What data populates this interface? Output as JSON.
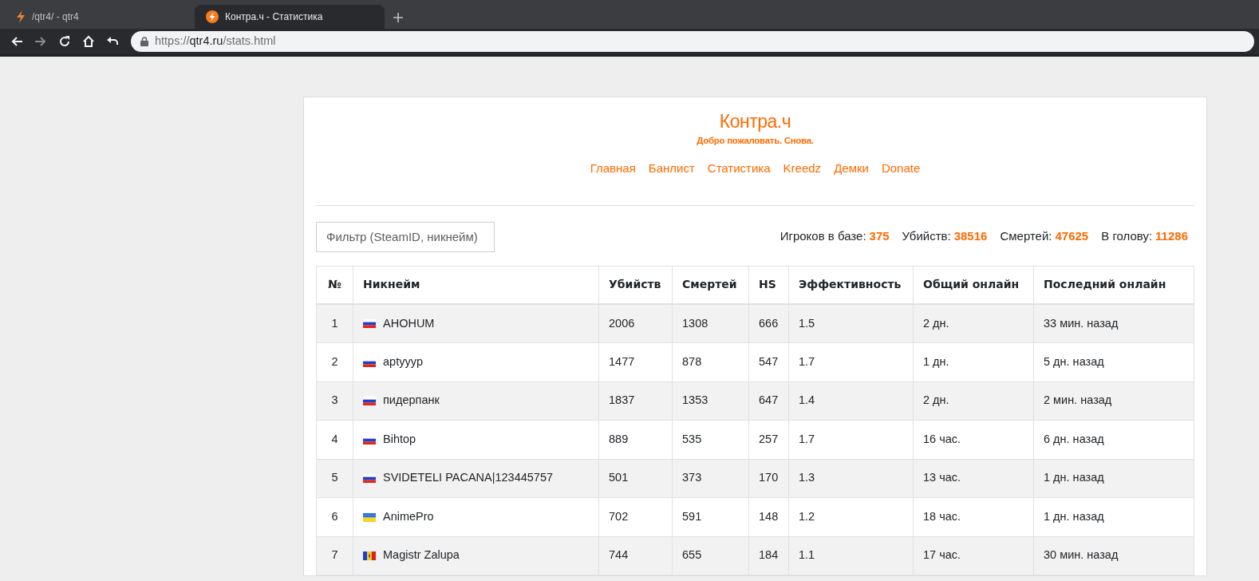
{
  "browser": {
    "tabs": [
      {
        "title": "/qtr4/ - qtr4",
        "kind": "bolt",
        "selected": false
      },
      {
        "title": "Контра.ч - Статистика",
        "kind": "disc",
        "selected": true
      }
    ],
    "nav_buttons": [
      {
        "kind": "back",
        "disabled": false
      },
      {
        "kind": "forward",
        "disabled": true
      },
      {
        "kind": "reload",
        "disabled": false
      },
      {
        "kind": "home",
        "disabled": false
      },
      {
        "kind": "undo",
        "disabled": false
      }
    ],
    "url": {
      "scheme": "https://",
      "host": "qtr4.ru",
      "path": "/stats.html"
    }
  },
  "site": {
    "title": "Контра.ч",
    "subtitle": "Добро пожаловать. Снова.",
    "menu": [
      "Главная",
      "Банлист",
      "Статистика",
      "Kreedz",
      "Демки",
      "Donate"
    ]
  },
  "filter": {
    "placeholder": "Фильтр (SteamID, никнейм)"
  },
  "totals": [
    {
      "label": "Игроков в базе:",
      "value": "375"
    },
    {
      "label": "Убийств:",
      "value": "38516"
    },
    {
      "label": "Смертей:",
      "value": "47625"
    },
    {
      "label": "В голову:",
      "value": "11286"
    }
  ],
  "table": {
    "columns": [
      "№",
      "Никнейм",
      "Убийств",
      "Смертей",
      "HS",
      "Эффективность",
      "Общий онлайн",
      "Последний онлайн"
    ],
    "rows": [
      {
        "cells": [
          "1",
          "AHOHUM",
          "2006",
          "1308",
          "666",
          "1.5",
          "2 дн.",
          "33 мин. назад"
        ],
        "kind": "ru"
      },
      {
        "cells": [
          "2",
          "aptyyyp",
          "1477",
          "878",
          "547",
          "1.7",
          "1 дн.",
          "5 дн. назад"
        ],
        "kind": "ru"
      },
      {
        "cells": [
          "3",
          "пидерпанк",
          "1837",
          "1353",
          "647",
          "1.4",
          "2 дн.",
          "2 мин. назад"
        ],
        "kind": "ru"
      },
      {
        "cells": [
          "4",
          "Bihtop",
          "889",
          "535",
          "257",
          "1.7",
          "16 час.",
          "6 дн. назад"
        ],
        "kind": "ru"
      },
      {
        "cells": [
          "5",
          "SVIDETELI PACANA|123445757",
          "501",
          "373",
          "170",
          "1.3",
          "13 час.",
          "1 дн. назад"
        ],
        "kind": "ru"
      },
      {
        "cells": [
          "6",
          "AnimePro",
          "702",
          "591",
          "148",
          "1.2",
          "18 час.",
          "1 дн. назад"
        ],
        "kind": "ua"
      },
      {
        "cells": [
          "7",
          "Magistr Zalupa",
          "744",
          "655",
          "184",
          "1.1",
          "17 час.",
          "30 мин. назад"
        ],
        "kind": "md"
      }
    ]
  }
}
